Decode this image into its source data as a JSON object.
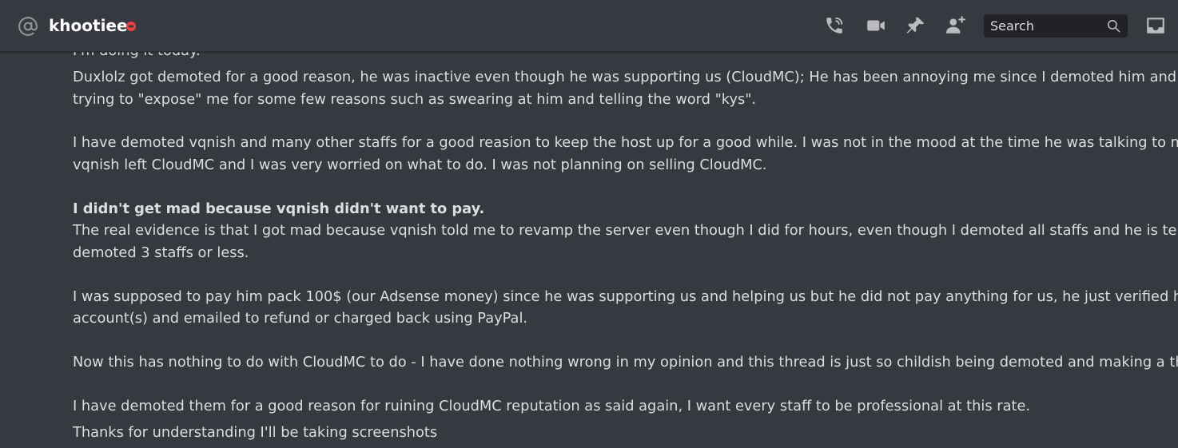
{
  "header": {
    "username": "khootiee",
    "status": "do-not-disturb",
    "icons": {
      "at": "at-icon",
      "dnd": "dnd-status-icon",
      "call": "voice-call-icon",
      "video": "video-call-icon",
      "pin": "pin-icon",
      "add_friend": "add-friend-icon",
      "search": "search-icon",
      "inbox": "inbox-icon"
    },
    "search_placeholder": "Search"
  },
  "colors": {
    "background": "#36393f",
    "text": "#dcddde",
    "icon": "#b9bbbe",
    "dnd": "#ed4245",
    "search_bg": "#202225"
  },
  "messages": {
    "lines": [
      "I'm doing it today.",
      "Duxlolz got demoted for a good reason, he was inactive even though he was supporting us (CloudMC); He has been annoying me since I demoted him and now he is",
      "trying to \"expose\" me for some few reasons such as swearing at him and telling the word \"kys\".",
      "I have demoted vqnish and many other staffs for a good reasion to keep the host up for a good while. I was not in the mood at the time he was talking to me since",
      "vqnish left CloudMC and I was very worried on what to do. I was not planning on selling CloudMC.",
      "I didn't get mad because vqnish didn't want to pay.",
      "The real evidence is that I got mad because vqnish told me to revamp the server even though I did for hours, even though I demoted all staffs and he is telling that I",
      "demoted 3 staffs or less.",
      "I was supposed to pay him pack 100$ (our Adsense money) since he was supporting us and helping us but he did not pay anything for us, he just verified hetzner",
      "account(s) and emailed to refund or charged back using PayPal.",
      "Now this has nothing to do with CloudMC to do - I have done nothing wrong in my opinion and this thread is just so childish being demoted and making a thread.",
      "I have demoted them for a good reason for ruining CloudMC reputation as said again, I want every staff to be professional at this rate.",
      "Thanks for understanding I'll be taking screenshots"
    ]
  }
}
